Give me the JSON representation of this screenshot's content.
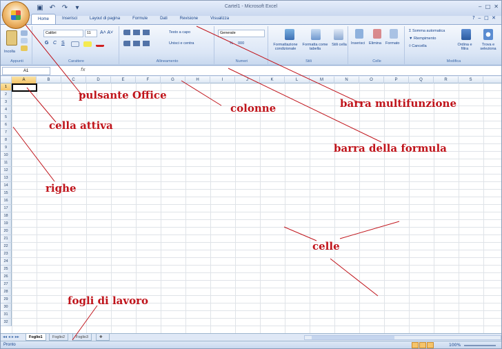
{
  "window": {
    "title": "Cartel1 - Microsoft Excel",
    "help_icon": "help-icon"
  },
  "ribbon": {
    "tabs": [
      "Home",
      "Inserisci",
      "Layout di pagina",
      "Formule",
      "Dati",
      "Revisione",
      "Visualizza"
    ],
    "clipboard": {
      "paste": "Incolla",
      "label": "Appunti"
    },
    "font": {
      "name": "Calibri",
      "size": "11",
      "label": "Carattere",
      "bold": "G",
      "italic": "C",
      "underline": "S"
    },
    "alignment": {
      "wrap": "Testo a capo",
      "merge": "Unisci e centra",
      "label": "Allineamento"
    },
    "number": {
      "format": "Generale",
      "percent": "%",
      "thousands": "000",
      "label": "Numeri"
    },
    "styles": {
      "conditional": "Formattazione condizionale",
      "table": "Formatta come tabella",
      "cell": "Stili cella",
      "label": "Stili"
    },
    "cells": {
      "insert": "Inserisci",
      "delete": "Elimina",
      "format": "Formato",
      "label": "Celle"
    },
    "editing": {
      "autosum": "Somma automatica",
      "fill": "Riempimento",
      "clear": "Cancella",
      "sort": "Ordina e filtra",
      "find": "Trova e seleziona",
      "label": "Modifica"
    }
  },
  "formula_bar": {
    "name_box": "A1",
    "fx": "fx"
  },
  "columns": [
    "A",
    "B",
    "C",
    "D",
    "E",
    "F",
    "G",
    "H",
    "I",
    "J",
    "K",
    "L",
    "M",
    "N",
    "O",
    "P",
    "Q",
    "R",
    "S"
  ],
  "rows": [
    "1",
    "2",
    "3",
    "4",
    "5",
    "6",
    "7",
    "8",
    "9",
    "10",
    "11",
    "12",
    "13",
    "14",
    "15",
    "16",
    "17",
    "18",
    "19",
    "20",
    "21",
    "22",
    "23",
    "24",
    "25",
    "26",
    "27",
    "28",
    "29",
    "30",
    "31",
    "32"
  ],
  "sheets": [
    "Foglio1",
    "Foglio2",
    "Foglio3"
  ],
  "status": {
    "ready": "Pronto",
    "zoom": "100%"
  },
  "annotations": {
    "office_button": "pulsante Office",
    "ribbon": "barra multifunzione",
    "active_cell": "cella attiva",
    "columns": "colonne",
    "formula_bar": "barra della formula",
    "rows": "righe",
    "cells": "celle",
    "sheets": "fogli di lavoro"
  },
  "colors": {
    "annotation": "#c0141b",
    "ribbon": "#dbe6f6",
    "selection": "#f5c46a"
  }
}
